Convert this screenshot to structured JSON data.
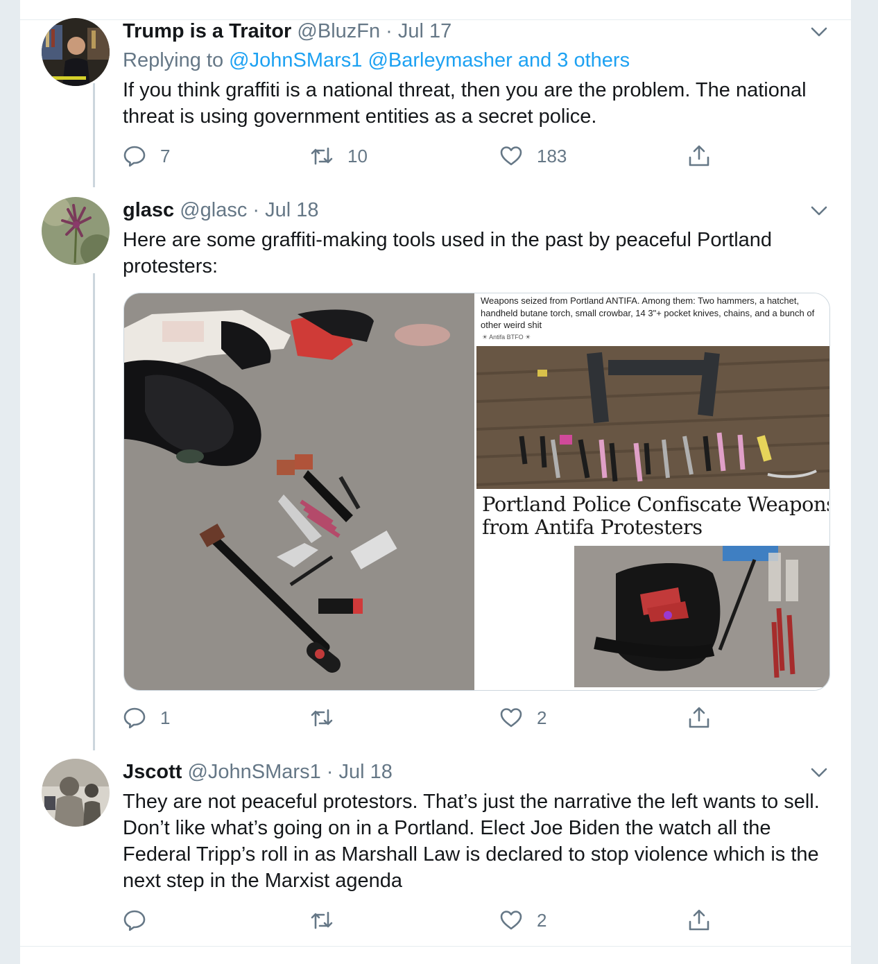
{
  "tweets": [
    {
      "display_name": "Trump is a Traitor",
      "handle": "@BluzFn",
      "date": "Jul 17",
      "replying_prefix": "Replying to ",
      "replying_to": "@JohnSMars1 @Barleymasher and 3 others",
      "text": "If you think graffiti is a national threat, then you are the problem. The national threat is using government entities as a secret police.",
      "replies": "7",
      "retweets": "10",
      "likes": "183"
    },
    {
      "display_name": "glasc",
      "handle": "@glasc",
      "date": "Jul 18",
      "text": "Here are some graffiti-making tools used in the past by peaceful Portland protesters:",
      "replies": "1",
      "retweets": "",
      "likes": "2",
      "media": {
        "caption": "Weapons seized from Portland ANTIFA. Among them: Two hammers, a hatchet, handheld butane torch, small crowbar, 14 3\"+ pocket knives, chains, and a bunch of other weird shit",
        "caption_tag": "☀ Antifa BTFO ☀",
        "headline_line1": "Portland Police Confiscate Weapons, Dy",
        "headline_line2": "from Antifa Protesters"
      }
    },
    {
      "display_name": "Jscott",
      "handle": "@JohnSMars1",
      "date": "Jul 18",
      "text": "They are not peaceful protestors. That’s just the narrative the left wants to sell. Don’t like what’s going on in a Portland. Elect Joe Biden the watch all the Federal Tripp’s roll in as Marshall Law is declared to stop violence which is the next step in the Marxist agenda",
      "replies": "",
      "retweets": "",
      "likes": "2"
    }
  ],
  "separator": " · ",
  "icons": [
    "reply-icon",
    "retweet-icon",
    "like-icon",
    "share-icon",
    "chevron-down-icon"
  ],
  "colors": {
    "link": "#1da1f2",
    "muted": "#657786",
    "text": "#14171a",
    "thread_line": "#ccd6dd",
    "background": "#e6ecf0"
  }
}
